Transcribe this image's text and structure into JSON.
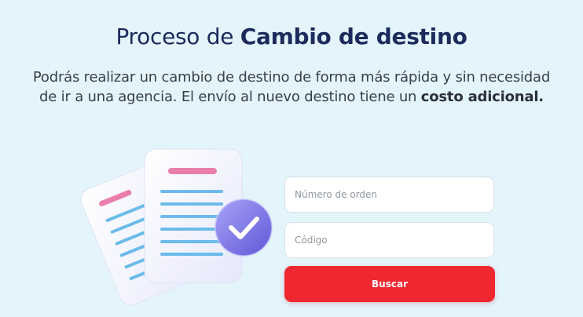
{
  "header": {
    "title_prefix": "Proceso de ",
    "title_bold": "Cambio de destino"
  },
  "description": {
    "line1": "Podrás realizar un cambio de destino de forma más rápida y sin necesidad",
    "line2_text": "de ir a una agencia. El envío al nuevo destino tiene un ",
    "line2_bold": "costo adicional."
  },
  "form": {
    "order_placeholder": "Número de orden",
    "code_placeholder": "Código",
    "search_label": "Buscar"
  },
  "illustration": {
    "icon": "documents-check-icon"
  },
  "colors": {
    "background": "#e3f4fb",
    "title": "#1c2a5c",
    "button": "#ef2730"
  }
}
